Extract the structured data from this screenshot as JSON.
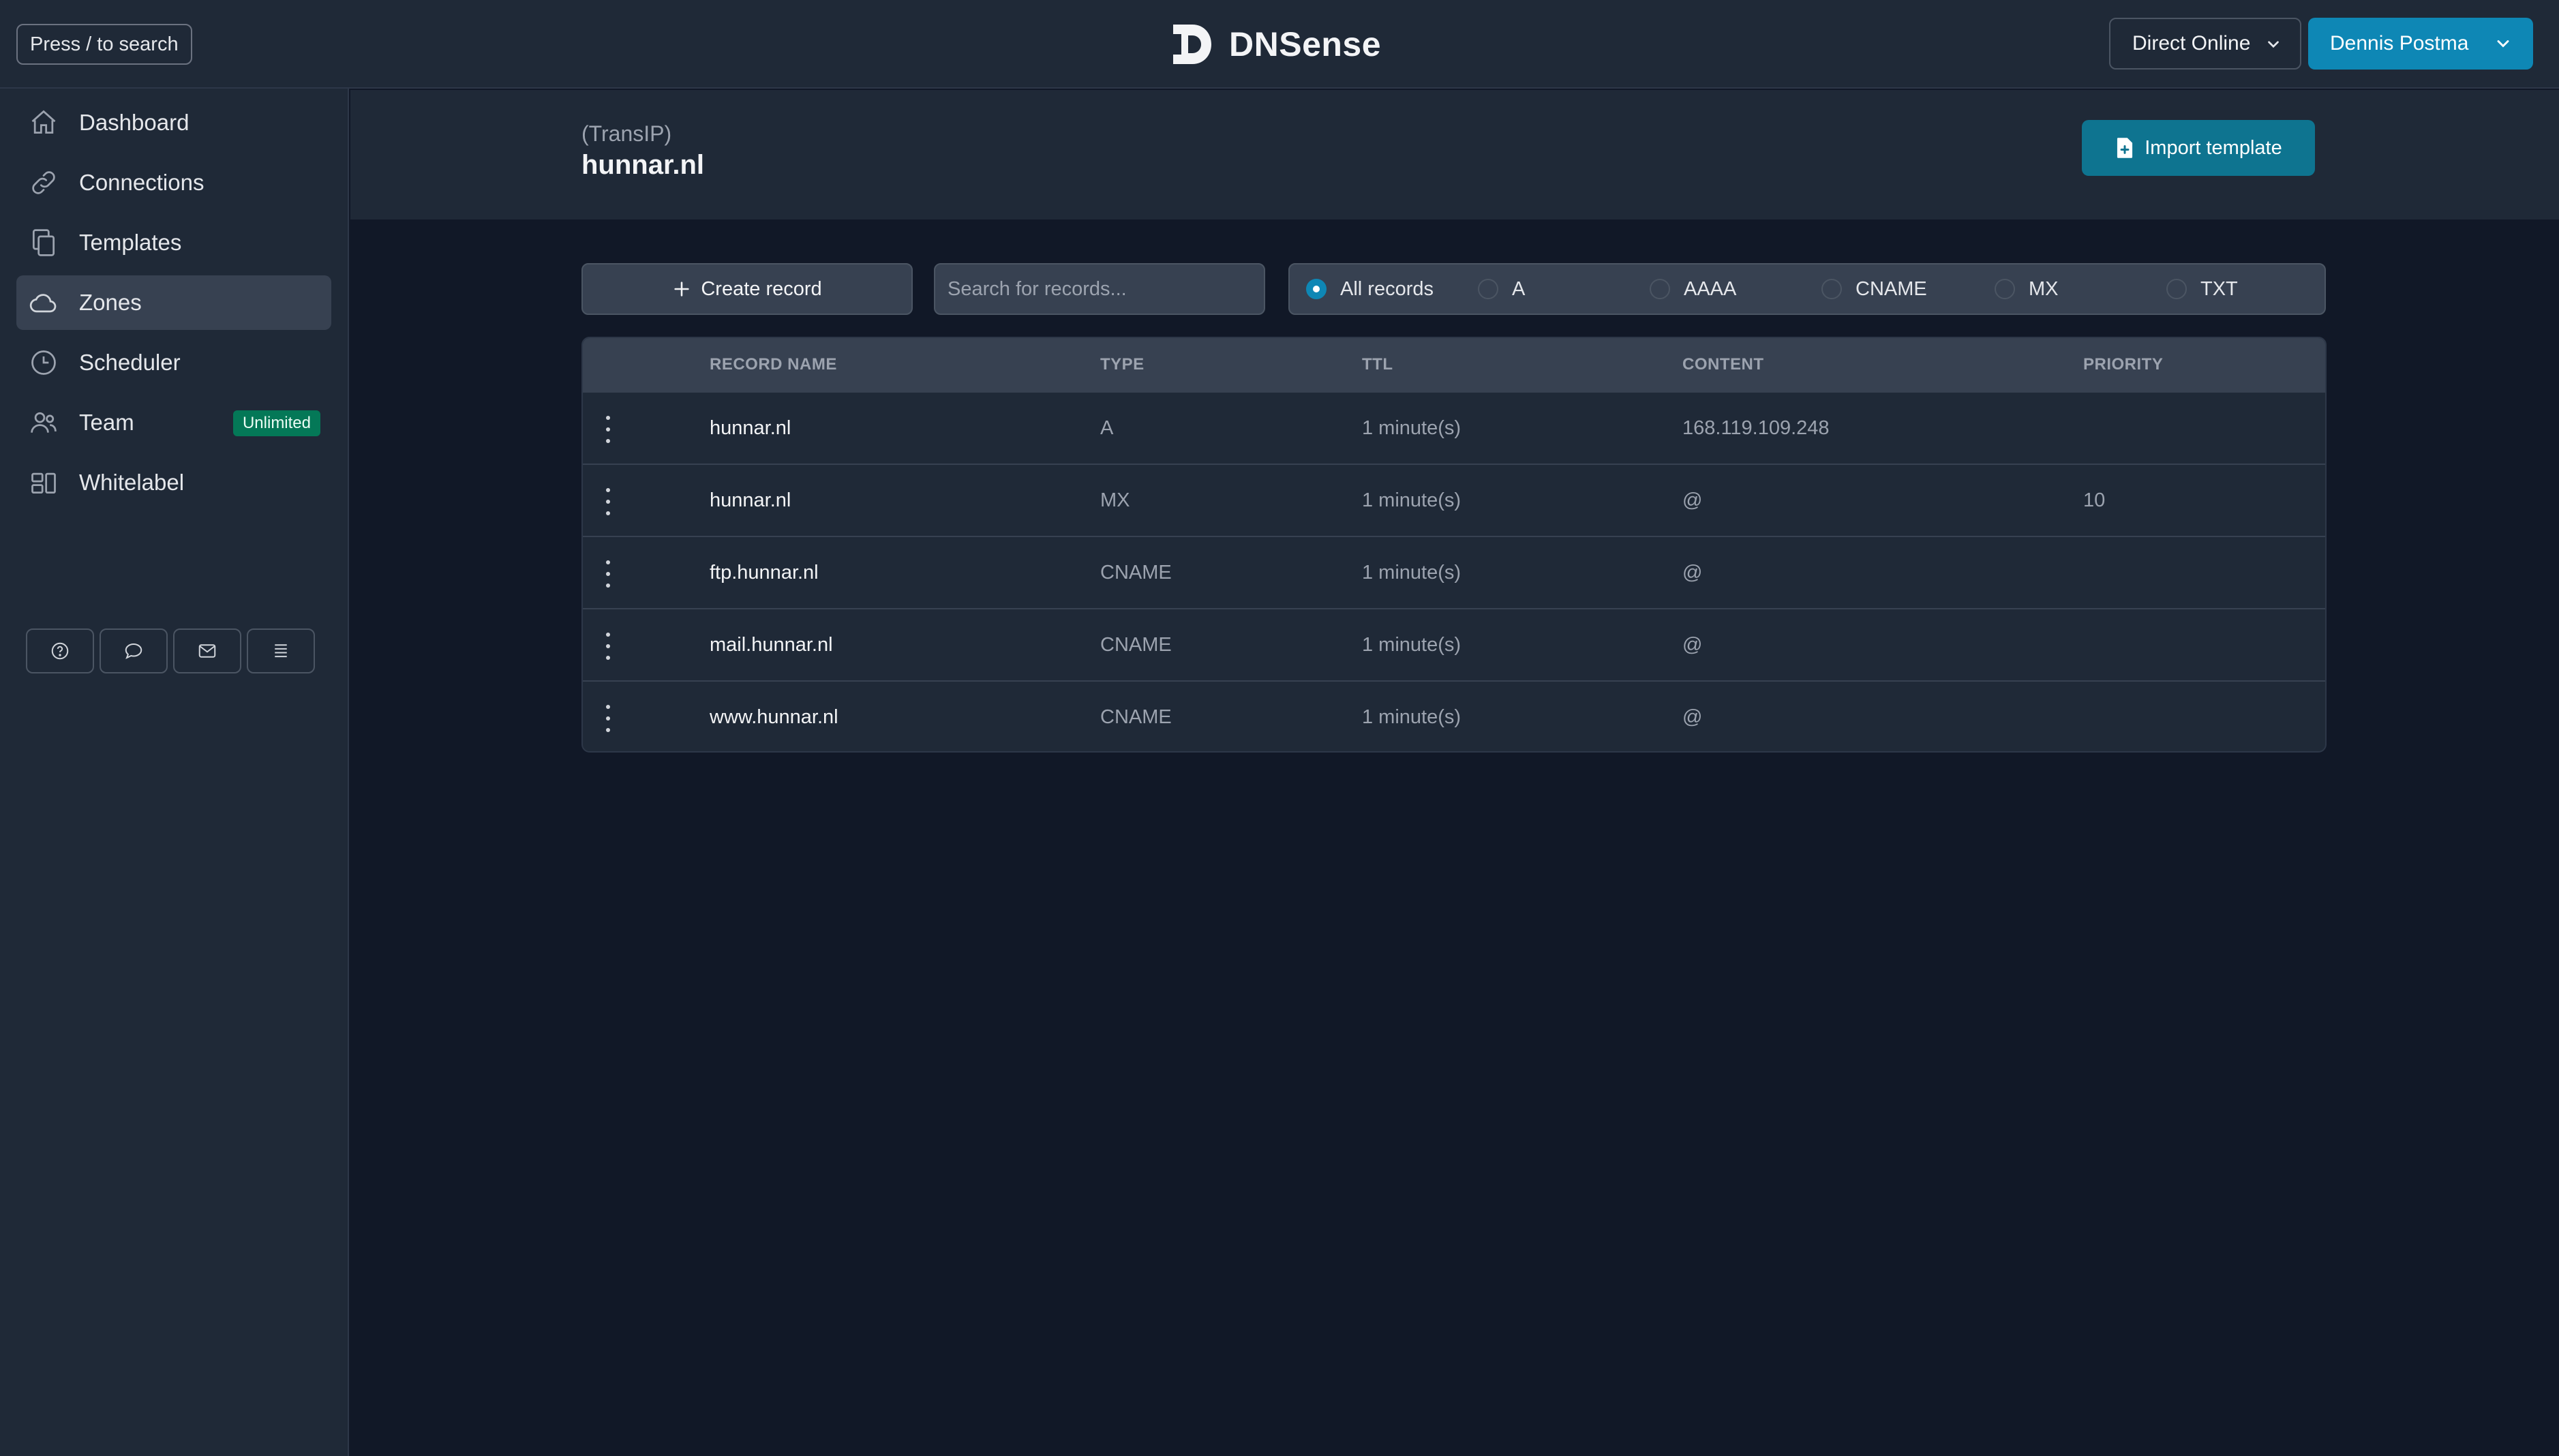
{
  "topbar": {
    "search_hint": "Press / to search",
    "brand_name": "DNSense",
    "org_selector": "Direct Online",
    "user_name": "Dennis Postma"
  },
  "sidebar": {
    "items": [
      {
        "label": "Dashboard",
        "icon": "home-icon"
      },
      {
        "label": "Connections",
        "icon": "link-icon"
      },
      {
        "label": "Templates",
        "icon": "copy-icon"
      },
      {
        "label": "Zones",
        "icon": "cloud-icon",
        "active": true
      },
      {
        "label": "Scheduler",
        "icon": "clock-icon"
      },
      {
        "label": "Team",
        "icon": "users-icon",
        "badge": "Unlimited"
      },
      {
        "label": "Whitelabel",
        "icon": "layout-icon"
      }
    ],
    "help_icons": [
      "help-circle-icon",
      "chat-bubble-icon",
      "mail-icon",
      "list-icon"
    ]
  },
  "zone": {
    "provider": "(TransIP)",
    "name": "hunnar.nl",
    "import_label": "Import template"
  },
  "toolbar": {
    "create_label": "Create record",
    "search_placeholder": "Search for records...",
    "filters": [
      "All records",
      "A",
      "AAAA",
      "CNAME",
      "MX",
      "TXT"
    ],
    "selected_filter": "All records"
  },
  "table": {
    "columns": [
      "RECORD NAME",
      "TYPE",
      "TTL",
      "CONTENT",
      "PRIORITY"
    ],
    "rows": [
      {
        "name": "hunnar.nl",
        "type": "A",
        "ttl": "1 minute(s)",
        "content": "168.119.109.248",
        "priority": ""
      },
      {
        "name": "hunnar.nl",
        "type": "MX",
        "ttl": "1 minute(s)",
        "content": "@",
        "priority": "10"
      },
      {
        "name": "ftp.hunnar.nl",
        "type": "CNAME",
        "ttl": "1 minute(s)",
        "content": "@",
        "priority": ""
      },
      {
        "name": "mail.hunnar.nl",
        "type": "CNAME",
        "ttl": "1 minute(s)",
        "content": "@",
        "priority": ""
      },
      {
        "name": "www.hunnar.nl",
        "type": "CNAME",
        "ttl": "1 minute(s)",
        "content": "@",
        "priority": ""
      }
    ]
  },
  "colors": {
    "background": "#111827",
    "panel": "#1f2937",
    "accent": "#0e87b5",
    "import_button": "#0e7490",
    "badge": "#047857"
  }
}
